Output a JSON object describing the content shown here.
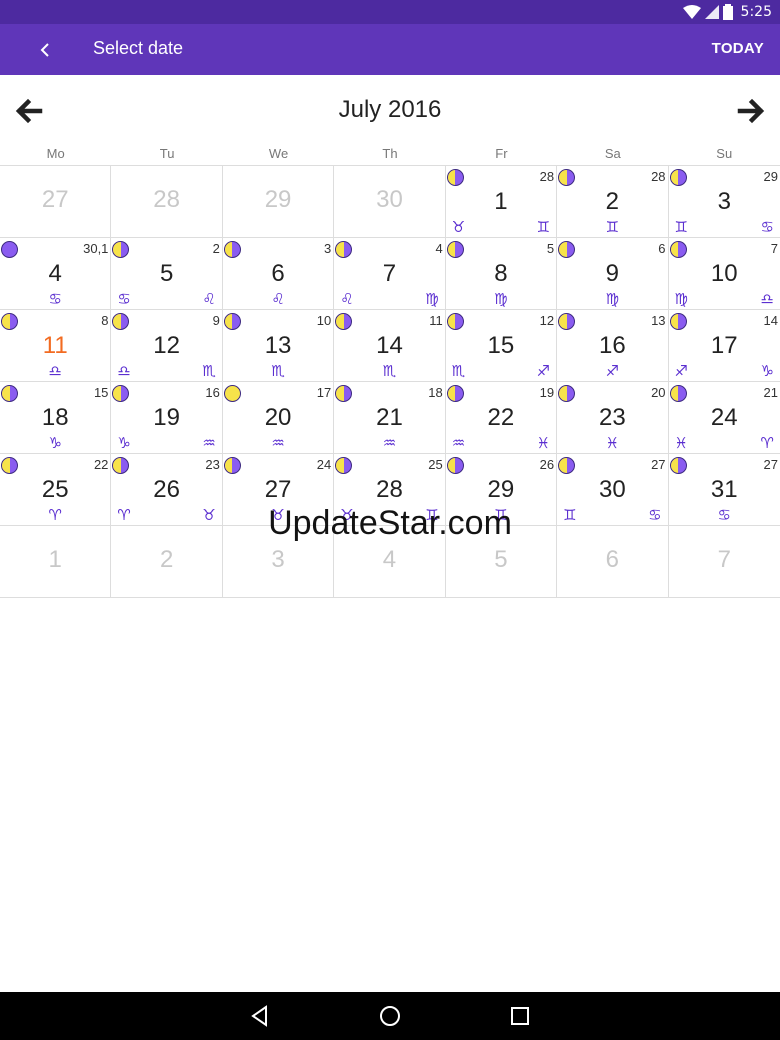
{
  "status": {
    "time": "5:25"
  },
  "app_bar": {
    "title": "Select date",
    "today_label": "TODAY"
  },
  "calendar": {
    "month_title": "July 2016",
    "weekdays": [
      "Mo",
      "Tu",
      "We",
      "Th",
      "Fr",
      "Sa",
      "Su"
    ],
    "weeks": [
      [
        {
          "day": "27",
          "muted": true
        },
        {
          "day": "28",
          "muted": true
        },
        {
          "day": "29",
          "muted": true
        },
        {
          "day": "30",
          "muted": true
        },
        {
          "day": "1",
          "moon": "waning",
          "lunar": "28",
          "zodiac": [
            {
              "sym": "♉",
              "pos": "left"
            },
            {
              "sym": "♊",
              "pos": "right"
            }
          ]
        },
        {
          "day": "2",
          "moon": "waning",
          "lunar": "28",
          "zodiac": [
            {
              "sym": "♊",
              "pos": "center"
            }
          ]
        },
        {
          "day": "3",
          "moon": "waning",
          "lunar": "29",
          "zodiac": [
            {
              "sym": "♊",
              "pos": "left"
            },
            {
              "sym": "♋",
              "pos": "right"
            }
          ]
        }
      ],
      [
        {
          "day": "4",
          "moon": "new",
          "lunar": "30,1",
          "zodiac": [
            {
              "sym": "♋",
              "pos": "center"
            }
          ]
        },
        {
          "day": "5",
          "moon": "waxing",
          "lunar": "2",
          "zodiac": [
            {
              "sym": "♋",
              "pos": "left"
            },
            {
              "sym": "♌",
              "pos": "right"
            }
          ]
        },
        {
          "day": "6",
          "moon": "waxing",
          "lunar": "3",
          "zodiac": [
            {
              "sym": "♌",
              "pos": "center"
            }
          ]
        },
        {
          "day": "7",
          "moon": "waxing",
          "lunar": "4",
          "zodiac": [
            {
              "sym": "♌",
              "pos": "left"
            },
            {
              "sym": "♍",
              "pos": "right"
            }
          ]
        },
        {
          "day": "8",
          "moon": "waxing",
          "lunar": "5",
          "zodiac": [
            {
              "sym": "♍",
              "pos": "center"
            }
          ]
        },
        {
          "day": "9",
          "moon": "waxing",
          "lunar": "6",
          "zodiac": [
            {
              "sym": "♍",
              "pos": "center"
            }
          ]
        },
        {
          "day": "10",
          "moon": "waxing",
          "lunar": "7",
          "zodiac": [
            {
              "sym": "♍",
              "pos": "left"
            },
            {
              "sym": "♎",
              "pos": "right"
            }
          ]
        }
      ],
      [
        {
          "day": "11",
          "today": true,
          "moon": "waxing",
          "lunar": "8",
          "zodiac": [
            {
              "sym": "♎",
              "pos": "center"
            }
          ]
        },
        {
          "day": "12",
          "moon": "waxing",
          "lunar": "9",
          "zodiac": [
            {
              "sym": "♎",
              "pos": "left"
            },
            {
              "sym": "♏",
              "pos": "right"
            }
          ]
        },
        {
          "day": "13",
          "moon": "waxing",
          "lunar": "10",
          "zodiac": [
            {
              "sym": "♏",
              "pos": "center"
            }
          ]
        },
        {
          "day": "14",
          "moon": "waxing",
          "lunar": "11",
          "zodiac": [
            {
              "sym": "♏",
              "pos": "center"
            }
          ]
        },
        {
          "day": "15",
          "moon": "waxing",
          "lunar": "12",
          "zodiac": [
            {
              "sym": "♏",
              "pos": "left"
            },
            {
              "sym": "♐",
              "pos": "right"
            }
          ]
        },
        {
          "day": "16",
          "moon": "waxing",
          "lunar": "13",
          "zodiac": [
            {
              "sym": "♐",
              "pos": "center"
            }
          ]
        },
        {
          "day": "17",
          "moon": "waxing",
          "lunar": "14",
          "zodiac": [
            {
              "sym": "♐",
              "pos": "left"
            },
            {
              "sym": "♑",
              "pos": "right"
            }
          ]
        }
      ],
      [
        {
          "day": "18",
          "moon": "waning",
          "lunar": "15",
          "zodiac": [
            {
              "sym": "♑",
              "pos": "center"
            }
          ]
        },
        {
          "day": "19",
          "moon": "waning",
          "lunar": "16",
          "zodiac": [
            {
              "sym": "♑",
              "pos": "left"
            },
            {
              "sym": "♒",
              "pos": "right"
            }
          ]
        },
        {
          "day": "20",
          "moon": "full",
          "lunar": "17",
          "zodiac": [
            {
              "sym": "♒",
              "pos": "center"
            }
          ]
        },
        {
          "day": "21",
          "moon": "waning",
          "lunar": "18",
          "zodiac": [
            {
              "sym": "♒",
              "pos": "center"
            }
          ]
        },
        {
          "day": "22",
          "moon": "waning",
          "lunar": "19",
          "zodiac": [
            {
              "sym": "♒",
              "pos": "left"
            },
            {
              "sym": "♓",
              "pos": "right"
            }
          ]
        },
        {
          "day": "23",
          "moon": "waning",
          "lunar": "20",
          "zodiac": [
            {
              "sym": "♓",
              "pos": "center"
            }
          ]
        },
        {
          "day": "24",
          "moon": "waning",
          "lunar": "21",
          "zodiac": [
            {
              "sym": "♓",
              "pos": "left"
            },
            {
              "sym": "♈",
              "pos": "right"
            }
          ]
        }
      ],
      [
        {
          "day": "25",
          "moon": "waning",
          "lunar": "22",
          "zodiac": [
            {
              "sym": "♈",
              "pos": "center"
            }
          ]
        },
        {
          "day": "26",
          "moon": "waning",
          "lunar": "23",
          "zodiac": [
            {
              "sym": "♈",
              "pos": "left"
            },
            {
              "sym": "♉",
              "pos": "right"
            }
          ]
        },
        {
          "day": "27",
          "moon": "waning",
          "lunar": "24",
          "zodiac": [
            {
              "sym": "♉",
              "pos": "center"
            }
          ]
        },
        {
          "day": "28",
          "moon": "waning",
          "lunar": "25",
          "zodiac": [
            {
              "sym": "♉",
              "pos": "left"
            },
            {
              "sym": "♊",
              "pos": "right"
            }
          ]
        },
        {
          "day": "29",
          "moon": "waning",
          "lunar": "26",
          "zodiac": [
            {
              "sym": "♊",
              "pos": "center"
            }
          ]
        },
        {
          "day": "30",
          "moon": "waning",
          "lunar": "27",
          "zodiac": [
            {
              "sym": "♊",
              "pos": "left"
            },
            {
              "sym": "♋",
              "pos": "right"
            }
          ]
        },
        {
          "day": "31",
          "moon": "waning",
          "lunar": "27",
          "zodiac": [
            {
              "sym": "♋",
              "pos": "center"
            }
          ]
        }
      ],
      [
        {
          "day": "1",
          "muted": true
        },
        {
          "day": "2",
          "muted": true
        },
        {
          "day": "3",
          "muted": true
        },
        {
          "day": "4",
          "muted": true
        },
        {
          "day": "5",
          "muted": true
        },
        {
          "day": "6",
          "muted": true
        },
        {
          "day": "7",
          "muted": true
        }
      ]
    ]
  },
  "watermark": "UpdateStar.com",
  "colors": {
    "accent": "#5f36b9",
    "status": "#4d2aa0",
    "zodiac": "#5b2fd0",
    "today": "#f26b21",
    "moon_dark": "#8a5cf0",
    "moon_light": "#f7e34a"
  },
  "icons": {
    "back": "back-arrow-icon",
    "prev": "arrow-left-icon",
    "next": "arrow-right-icon"
  }
}
